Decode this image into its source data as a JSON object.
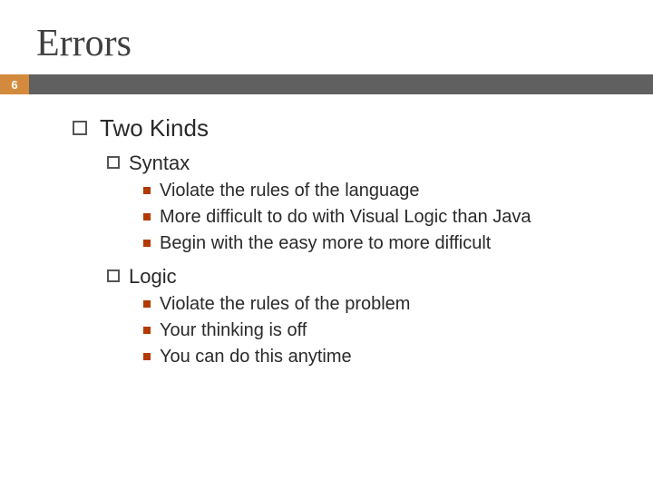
{
  "slide": {
    "title": "Errors",
    "page_number": "6",
    "level1": "Two Kinds",
    "sections": [
      {
        "heading": "Syntax",
        "items": [
          "Violate the rules of the language",
          "More difficult to do with Visual Logic than Java",
          "Begin with the easy more to more difficult"
        ]
      },
      {
        "heading": "Logic",
        "items": [
          "Violate the rules of the problem",
          "Your thinking is off",
          "You can do this anytime"
        ]
      }
    ]
  }
}
